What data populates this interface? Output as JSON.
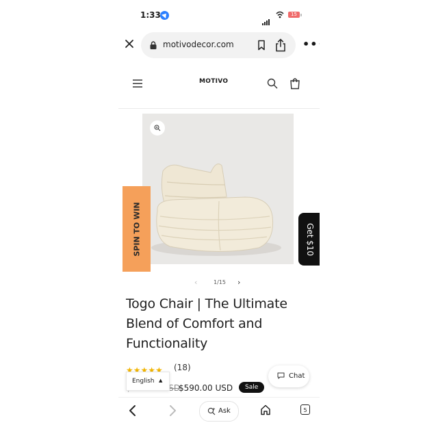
{
  "status_bar": {
    "time": "1:33",
    "battery": "15"
  },
  "browser": {
    "url": "motivodecor.com"
  },
  "site": {
    "logo": "MOTIVO"
  },
  "product": {
    "title": "Togo Chair | The Ultimate Blend of Comfort and Functionality",
    "image_counter": "1/15",
    "rating_count": "(18)",
    "stars": "★★★★★",
    "old_price": "$999.00 USD",
    "price": "$590.00 USD",
    "sale_badge": "Sale"
  },
  "promo": {
    "spin_label": "SPIN TO WIN",
    "get_label": "Get $10"
  },
  "language": {
    "selected": "English"
  },
  "chat": {
    "label": "Chat"
  },
  "bottom_bar": {
    "ask_label": "Ask",
    "tab_count": "5"
  },
  "colors": {
    "accent_orange": "#f5a05a",
    "star": "#f1b400",
    "badge": "#111111"
  }
}
